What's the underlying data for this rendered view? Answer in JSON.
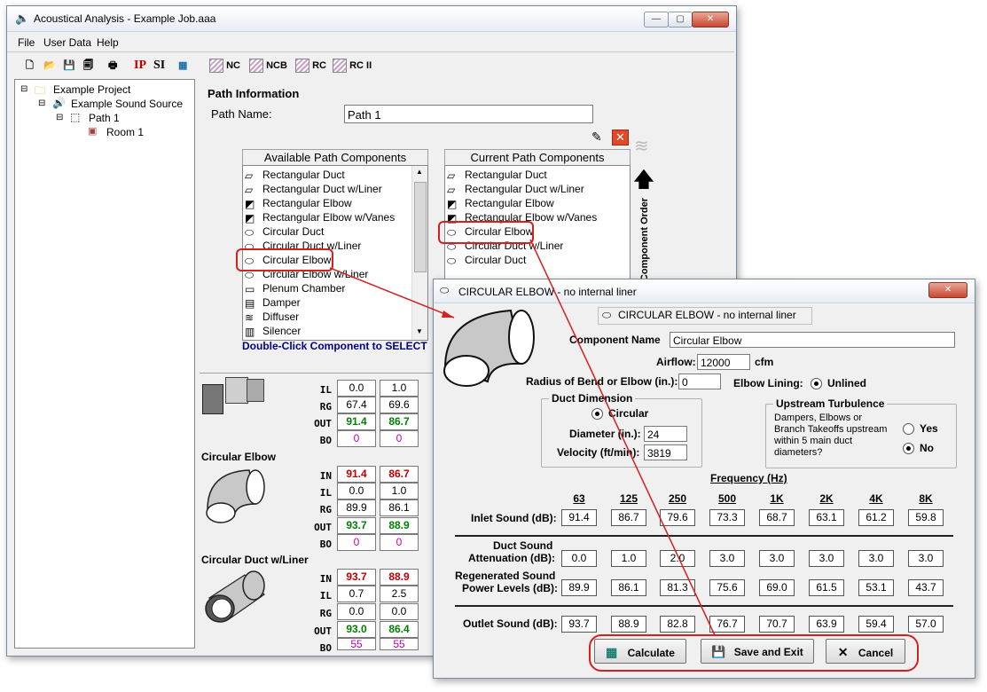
{
  "main_window": {
    "title": "Acoustical Analysis - Example Job.aaa",
    "menu": [
      "File",
      "User Data",
      "Help"
    ],
    "toolbar": {
      "ip": "IP",
      "si": "SI",
      "nc": "NC",
      "ncb": "NCB",
      "rc": "RC",
      "rc2": "RC II"
    }
  },
  "tree": {
    "project": "Example Project",
    "source": "Example Sound Source",
    "path": "Path 1",
    "room": "Room 1"
  },
  "path_info": {
    "heading": "Path Information",
    "name_label": "Path Name:",
    "name_value": "Path 1",
    "available_header": "Available Path Components",
    "current_header": "Current Path Components",
    "available": [
      "Rectangular Duct",
      "Rectangular Duct w/Liner",
      "Rectangular Elbow",
      "Rectangular Elbow w/Vanes",
      "Circular Duct",
      "Circular Duct w/Liner",
      "Circular Elbow",
      "Circular Elbow w/Liner",
      "Plenum Chamber",
      "Damper",
      "Diffuser",
      "Silencer"
    ],
    "current": [
      "Rectangular Duct",
      "Rectangular Duct w/Liner",
      "Rectangular Elbow",
      "Rectangular Elbow w/Vanes",
      "Circular Elbow",
      "Circular Duct w/Liner",
      "Circular Duct"
    ],
    "hint": "Double-Click Component to SELECT",
    "component_order_label": "Component Order"
  },
  "component_rows": {
    "labels": {
      "in": "IN",
      "il": "IL",
      "rg": "RG",
      "out": "OUT",
      "bo": "BO"
    },
    "block1": {
      "il": [
        "0.0",
        "1.0"
      ],
      "rg": [
        "67.4",
        "69.6"
      ],
      "out": [
        "91.4",
        "86.7"
      ],
      "bo": [
        "0",
        "0"
      ]
    },
    "block2_title": "Circular Elbow",
    "block2": {
      "in": [
        "91.4",
        "86.7"
      ],
      "il": [
        "0.0",
        "1.0"
      ],
      "rg": [
        "89.9",
        "86.1"
      ],
      "out": [
        "93.7",
        "88.9"
      ],
      "bo": [
        "0",
        "0"
      ]
    },
    "block3_title": "Circular Duct w/Liner",
    "block3": {
      "in": [
        "93.7",
        "88.9"
      ],
      "il": [
        "0.7",
        "2.5"
      ],
      "rg": [
        "0.0",
        "0.0"
      ],
      "out": [
        "93.0",
        "86.4"
      ],
      "bo": [
        "55",
        "55"
      ]
    }
  },
  "dialog": {
    "title": "CIRCULAR ELBOW - no internal liner",
    "subtitle": "CIRCULAR ELBOW - no internal liner",
    "component_name_label": "Component Name",
    "component_name_value": "Circular Elbow",
    "airflow_label": "Airflow:",
    "airflow_value": "12000",
    "airflow_unit": "cfm",
    "radius_label": "Radius of Bend or Elbow (in.):",
    "radius_value": "0",
    "lining_label": "Elbow Lining:",
    "lining_value": "Unlined",
    "duct_dimension_title": "Duct Dimension",
    "circular_label": "Circular",
    "diameter_label": "Diameter (in.):",
    "diameter_value": "24",
    "velocity_label": "Velocity (ft/min):",
    "velocity_value": "3819",
    "upstream_title": "Upstream Turbulence",
    "upstream_text": "Dampers, Elbows or Branch Takeoffs upstream within 5 main duct diameters?",
    "yes_label": "Yes",
    "no_label": "No",
    "frequency_title": "Frequency (Hz)",
    "frequencies": [
      "63",
      "125",
      "250",
      "500",
      "1K",
      "2K",
      "4K",
      "8K"
    ],
    "inlet_label": "Inlet Sound (dB):",
    "inlet": [
      "91.4",
      "86.7",
      "79.6",
      "73.3",
      "68.7",
      "63.1",
      "61.2",
      "59.8"
    ],
    "attenuation_label1": "Duct Sound",
    "attenuation_label2": "Attenuation (dB):",
    "attenuation": [
      "0.0",
      "1.0",
      "2.0",
      "3.0",
      "3.0",
      "3.0",
      "3.0",
      "3.0"
    ],
    "regen_label1": "Regenerated Sound",
    "regen_label2": "Power Levels (dB):",
    "regen": [
      "89.9",
      "86.1",
      "81.3",
      "75.6",
      "69.0",
      "61.5",
      "53.1",
      "43.7"
    ],
    "outlet_label": "Outlet Sound (dB):",
    "outlet": [
      "93.7",
      "88.9",
      "82.8",
      "76.7",
      "70.7",
      "63.9",
      "59.4",
      "57.0"
    ],
    "calculate_label": "Calculate",
    "save_label": "Save and Exit",
    "cancel_label": "Cancel"
  },
  "colors": {
    "out_green": "#008000",
    "in_red": "#c00000",
    "bo_magenta": "#c000c0",
    "highlight_red": "#d42020",
    "hint_blue": "#000080"
  }
}
